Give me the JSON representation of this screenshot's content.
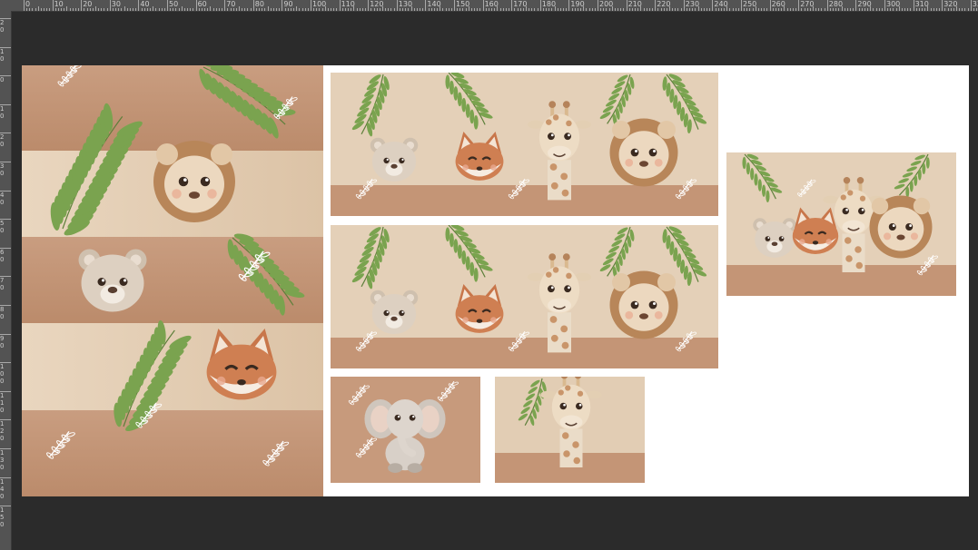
{
  "app": "image-editor",
  "ruler": {
    "top_labels": [
      "0",
      "10",
      "20",
      "30",
      "40",
      "50",
      "60",
      "70",
      "80",
      "90",
      "100",
      "110",
      "120",
      "130",
      "140",
      "150",
      "160",
      "170",
      "180",
      "190",
      "200",
      "210",
      "220",
      "230",
      "240",
      "250",
      "260",
      "270",
      "280",
      "290",
      "300",
      "310",
      "320",
      "33"
    ],
    "left_labels": [
      "2\n0",
      "1\n0",
      "0",
      "1\n0",
      "2\n0",
      "3\n0",
      "4\n0",
      "5\n0",
      "6\n0",
      "7\n0",
      "8\n0",
      "9\n0",
      "1\n0\n0",
      "1\n1\n0",
      "1\n2\n0",
      "1\n3\n0",
      "1\n4\n0",
      "1\n5\n0"
    ]
  },
  "colors": {
    "workspace": "#2b2b2b",
    "ruler": "#535353",
    "canvas": "#ffffff",
    "kraft_dark": "#c09071",
    "kraft_mid": "#c89c7e",
    "cream": "#e6d2bb",
    "leaf": "#7aa34f"
  },
  "panels": [
    {
      "name": "tall-banner-panel",
      "animals": [
        "lion",
        "bear",
        "fox"
      ]
    },
    {
      "name": "wide-banner-1",
      "animals": [
        "bear",
        "fox",
        "giraffe",
        "lion"
      ]
    },
    {
      "name": "wide-banner-2",
      "animals": [
        "bear",
        "fox",
        "giraffe",
        "lion"
      ]
    },
    {
      "name": "medium-group-panel",
      "animals": [
        "bear",
        "fox",
        "giraffe",
        "lion"
      ]
    },
    {
      "name": "elephant-panel",
      "animals": [
        "elephant"
      ]
    },
    {
      "name": "giraffe-panel",
      "animals": [
        "giraffe"
      ]
    }
  ]
}
